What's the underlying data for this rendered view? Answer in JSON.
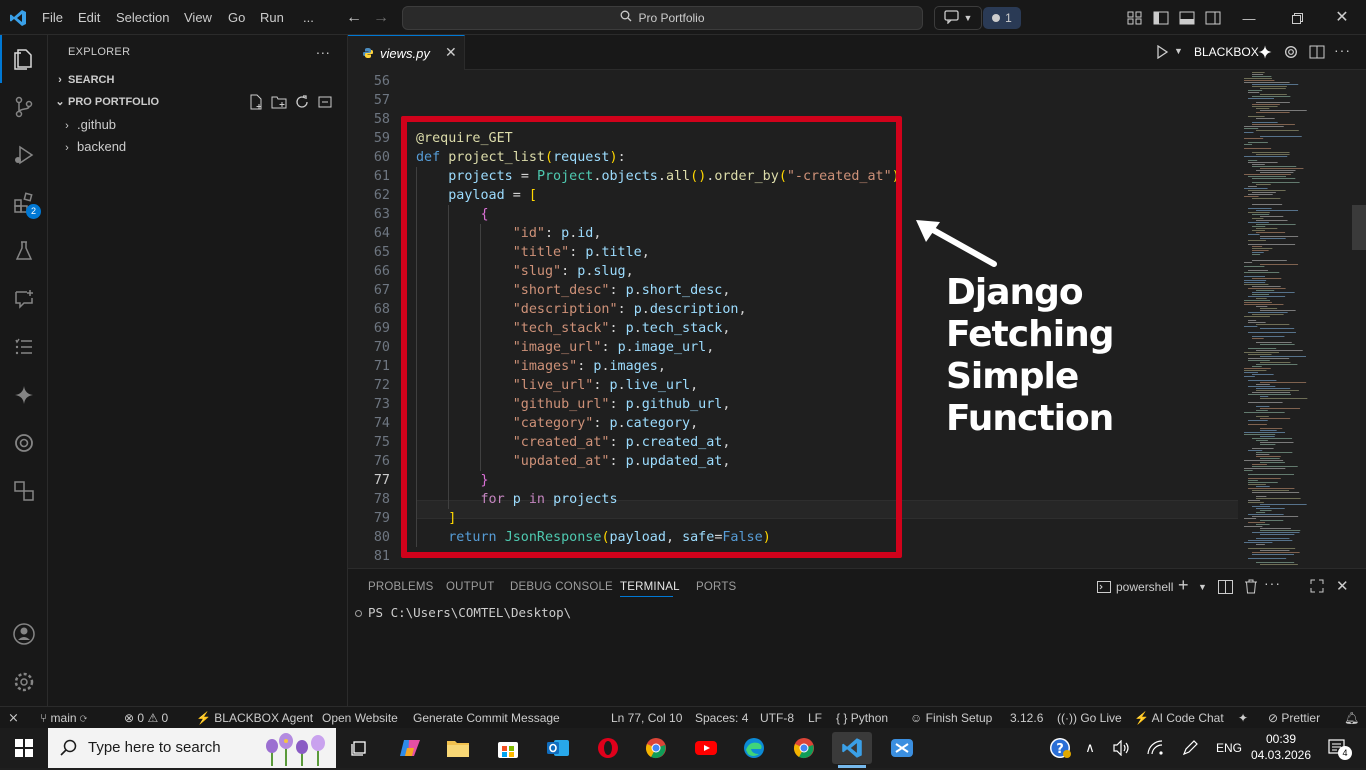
{
  "titlebar": {
    "menu": [
      "File",
      "Edit",
      "Selection",
      "View",
      "Go",
      "Run",
      "..."
    ],
    "search_text": "Pro Portfolio",
    "badge_count": "1"
  },
  "activity": {
    "extensions_badge": "2"
  },
  "sidebar": {
    "title": "EXPLORER",
    "more": "...",
    "search_section": "SEARCH",
    "project_section": "PRO PORTFOLIO",
    "folders": [
      ".github",
      "backend"
    ]
  },
  "editor": {
    "tab_name": "views.py",
    "run_label": "BLACKBOX",
    "active_line": 77,
    "lines": [
      {
        "n": "56",
        "html": ""
      },
      {
        "n": "57",
        "html": ""
      },
      {
        "n": "58",
        "html": ""
      },
      {
        "n": "59",
        "text": "@require_GET"
      },
      {
        "n": "60",
        "text": "def project_list(request):"
      },
      {
        "n": "61",
        "text": "    projects = Project.objects.all().order_by(\"-created_at\")"
      },
      {
        "n": "62",
        "text": "    payload = ["
      },
      {
        "n": "63",
        "text": "        {"
      },
      {
        "n": "64",
        "text": "            \"id\": p.id,"
      },
      {
        "n": "65",
        "text": "            \"title\": p.title,"
      },
      {
        "n": "66",
        "text": "            \"slug\": p.slug,"
      },
      {
        "n": "67",
        "text": "            \"short_desc\": p.short_desc,"
      },
      {
        "n": "68",
        "text": "            \"description\": p.description,"
      },
      {
        "n": "69",
        "text": "            \"tech_stack\": p.tech_stack,"
      },
      {
        "n": "70",
        "text": "            \"image_url\": p.image_url,"
      },
      {
        "n": "71",
        "text": "            \"images\": p.images,"
      },
      {
        "n": "72",
        "text": "            \"live_url\": p.live_url,"
      },
      {
        "n": "73",
        "text": "            \"github_url\": p.github_url,"
      },
      {
        "n": "74",
        "text": "            \"category\": p.category,"
      },
      {
        "n": "75",
        "text": "            \"created_at\": p.created_at,"
      },
      {
        "n": "76",
        "text": "            \"updated_at\": p.updated_at,"
      },
      {
        "n": "77",
        "text": "        }"
      },
      {
        "n": "78",
        "text": "        for p in projects"
      },
      {
        "n": "79",
        "text": "    ]"
      },
      {
        "n": "80",
        "text": "    return JsonResponse(payload, safe=False)"
      },
      {
        "n": "81",
        "text": ""
      }
    ],
    "annotation_line1": "Django Fetching",
    "annotation_line2": "Simple Function"
  },
  "panel": {
    "tabs": [
      "PROBLEMS",
      "OUTPUT",
      "DEBUG CONSOLE",
      "TERMINAL",
      "PORTS"
    ],
    "active_tab": "TERMINAL",
    "shell": "powershell",
    "prompt": "PS C:\\Users\\COMTEL\\Desktop\\"
  },
  "statusbar": {
    "branch": "main",
    "errors": "0",
    "warnings": "0",
    "blackbox": "BLACKBOX Agent",
    "open_website": "Open Website",
    "commit_msg": "Generate Commit Message",
    "position": "Ln 77, Col 10",
    "spaces": "Spaces: 4",
    "encoding": "UTF-8",
    "eol": "LF",
    "language": "Python",
    "finish_setup": "Finish Setup",
    "python_version": "3.12.6",
    "go_live": "Go Live",
    "ai_chat": "AI Code Chat",
    "prettier": "Prettier"
  },
  "taskbar": {
    "search_placeholder": "Type here to search",
    "language": "ENG",
    "time": "00:39",
    "date": "04.03.2026",
    "notification_count": "4"
  },
  "colors": {
    "highlight_border": "#d0021b",
    "accent": "#0078d4",
    "keyword": "#569cd6",
    "string": "#ce9178",
    "function": "#dcdcaa"
  }
}
